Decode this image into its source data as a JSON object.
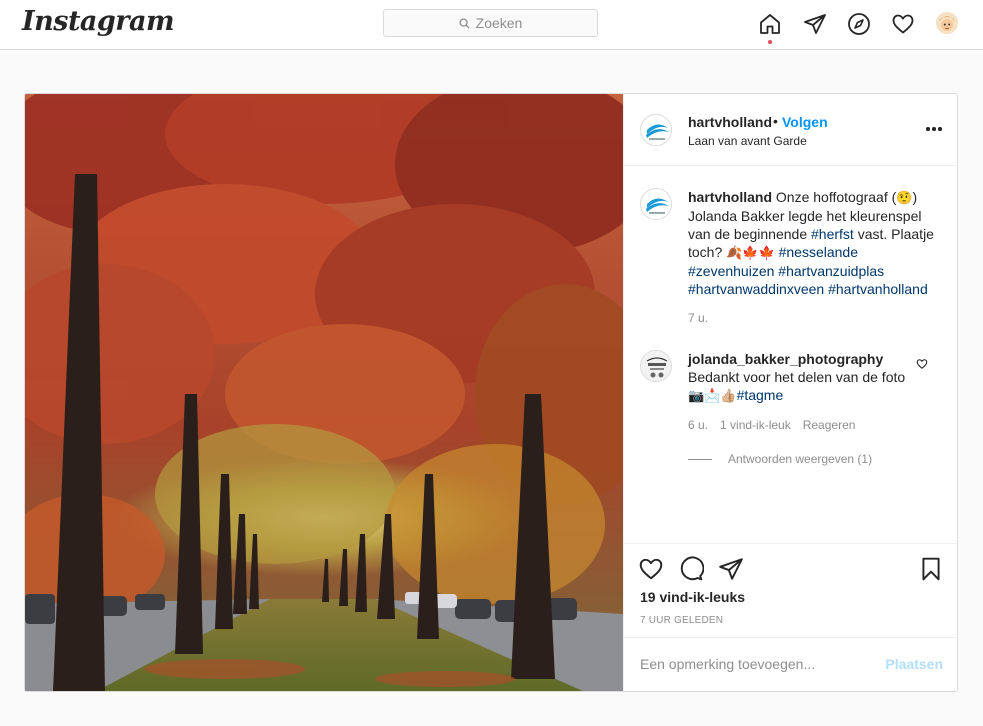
{
  "app": {
    "logo": "Instagram"
  },
  "search": {
    "placeholder": "Zoeken"
  },
  "nav": {
    "icons": [
      "home-icon",
      "direct-icon",
      "explore-icon",
      "activity-icon",
      "profile-avatar"
    ]
  },
  "post": {
    "header": {
      "username": "hartvholland",
      "separator": "•",
      "follow_label": "Volgen",
      "location": "Laan van avant Garde"
    },
    "caption": {
      "username": "hartvholland",
      "text_1": " Onze hoffotograaf (",
      "emoji_face": "🤨",
      "text_2": ") Jolanda Bakker legde het kleurenspel van de beginnende ",
      "tag_herfst": "#herfst",
      "text_3": " vast. Plaatje toch? ",
      "emojis": "🍂🍁🍁",
      "tag_1": "#nesselande",
      "tag_2": "#zevenhuizen",
      "tag_3": "#hartvanzuidplas",
      "tag_4": "#hartvanwaddinxveen",
      "tag_5": "#hartvanholland",
      "timestamp": "7 u."
    },
    "comment": {
      "username": "jolanda_bakker_photography",
      "text": "Bedankt voor het delen van de foto ",
      "emojis": "📷📩👍🏼",
      "tag": "#tagme",
      "time": "6 u.",
      "likes": "1 vind-ik-leuk",
      "reply": "Reageren",
      "view_replies": "Antwoorden weergeven (1)"
    },
    "likes_label": "19 vind-ik-leuks",
    "time_label": "7 UUR GELEDEN",
    "add_comment_placeholder": "Een opmerking toevoegen...",
    "post_button": "Plaatsen"
  },
  "colors": {
    "accent": "#0095f6",
    "link_tag": "#00376b",
    "muted": "#8e8e8e",
    "notification": "#ed4956"
  }
}
